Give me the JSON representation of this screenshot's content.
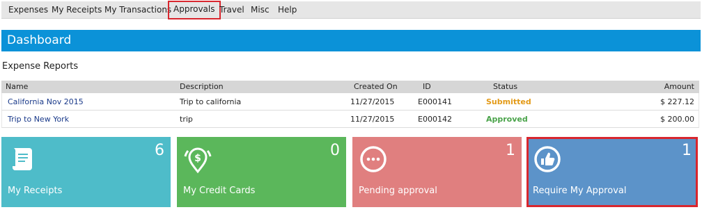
{
  "nav": {
    "items": [
      "Expenses",
      "My Receipts",
      "My Transactions",
      "Approvals",
      "Travel",
      "Misc",
      "Help"
    ],
    "highlighted": "Approvals"
  },
  "dashboard": {
    "title": "Dashboard"
  },
  "expense_reports": {
    "title": "Expense Reports",
    "columns": [
      "Name",
      "Description",
      "Created On",
      "ID",
      "Status",
      "Amount"
    ],
    "rows": [
      {
        "name": "California Nov 2015",
        "description": "Trip to california",
        "created_on": "11/27/2015",
        "id": "E000141",
        "status": "Submitted",
        "amount": "$ 227.12"
      },
      {
        "name": "Trip to New York",
        "description": "trip",
        "created_on": "11/27/2015",
        "id": "E000142",
        "status": "Approved",
        "amount": "$ 200.00"
      }
    ]
  },
  "tiles": [
    {
      "label": "My Receipts",
      "count": "6",
      "color": "#4ebcc9",
      "icon": "receipt-icon"
    },
    {
      "label": "My Credit Cards",
      "count": "0",
      "color": "#5bb75b",
      "icon": "money-pin-icon"
    },
    {
      "label": "Pending approval",
      "count": "1",
      "color": "#e07f7f",
      "icon": "ellipsis-circle-icon"
    },
    {
      "label": "Require My Approval",
      "count": "1",
      "color": "#5c93c9",
      "icon": "thumbs-up-icon"
    }
  ],
  "colors": {
    "header": "#0b92d8",
    "highlight_border": "#d8262e",
    "status_submitted": "#e39a17",
    "status_approved": "#4aa34a"
  }
}
